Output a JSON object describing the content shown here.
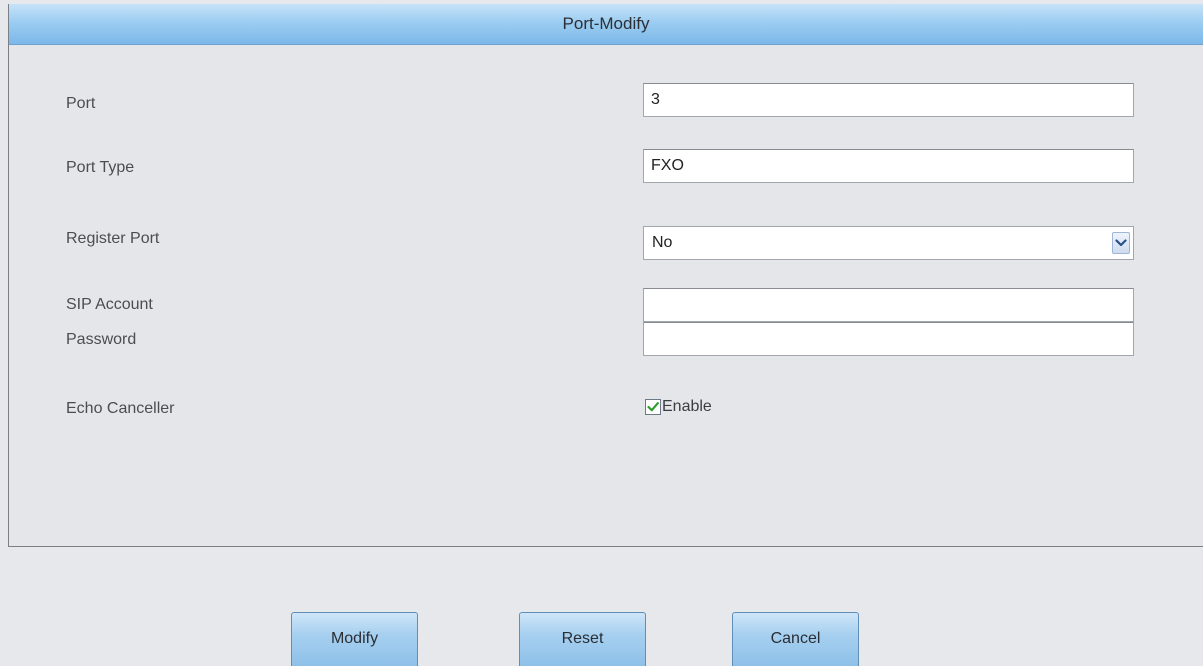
{
  "window": {
    "title": "Port-Modify"
  },
  "form": {
    "port": {
      "label": "Port",
      "value": "3"
    },
    "port_type": {
      "label": "Port Type",
      "value": "FXO"
    },
    "register_port": {
      "label": "Register Port",
      "value": "No",
      "options": [
        "No"
      ]
    },
    "sip_account": {
      "label": "SIP Account",
      "value": ""
    },
    "password": {
      "label": "Password",
      "value": ""
    },
    "echo_canceller": {
      "label": "Echo Canceller",
      "checkbox_label": "Enable",
      "checked": true
    }
  },
  "buttons": {
    "modify": "Modify",
    "reset": "Reset",
    "cancel": "Cancel"
  },
  "icons": {
    "select_arrow": "chevron-down-icon",
    "checkbox_mark": "checkmark-icon"
  },
  "colors": {
    "header_top": "#c6e3f9",
    "header_bottom": "#7cb8e9",
    "button_top": "#cfe6f8",
    "button_bottom": "#8ec0e8",
    "check_green": "#2e9c2e",
    "background": "#e6e8ec"
  }
}
